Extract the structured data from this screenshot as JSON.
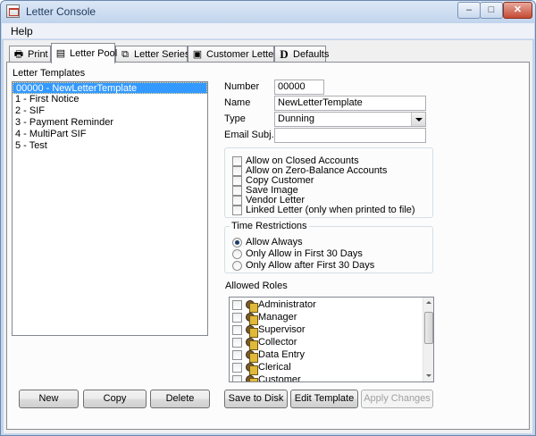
{
  "window": {
    "title": "Letter Console",
    "min": "–",
    "max": "□",
    "close": "✕"
  },
  "menu": {
    "help": "Help"
  },
  "tabs": [
    {
      "label": "Print",
      "icon": "printer-icon",
      "glyph": "🖶"
    },
    {
      "label": "Letter Pool",
      "icon": "document-icon",
      "glyph": "▤",
      "active": true
    },
    {
      "label": "Letter Series",
      "icon": "letter-series-icon",
      "glyph": "⧉"
    },
    {
      "label": "Customer Letters",
      "icon": "customer-letter-icon",
      "glyph": "▣"
    },
    {
      "label": "Defaults",
      "icon": "defaults-icon",
      "glyph": "D"
    }
  ],
  "letter_templates": {
    "heading": "Letter Templates",
    "items": [
      "00000 - NewLetterTemplate",
      "1 - First Notice",
      "2 - SIF",
      "3 - Payment Reminder",
      "4 - MultiPart SIF",
      "5 - Test"
    ]
  },
  "form": {
    "number_label": "Number",
    "number_value": "00000",
    "name_label": "Name",
    "name_value": "NewLetterTemplate",
    "type_label": "Type",
    "type_value": "Dunning",
    "email_label": "Email Subj.",
    "email_value": ""
  },
  "options": [
    "Allow on Closed Accounts",
    "Allow on Zero-Balance Accounts",
    "Copy Customer",
    "Save Image",
    "Vendor Letter",
    "Linked Letter (only when printed to file)"
  ],
  "time_restrictions": {
    "title": "Time Restrictions",
    "choices": [
      "Allow Always",
      "Only Allow in First 30 Days",
      "Only Allow after First 30 Days"
    ],
    "selected": "Allow Always"
  },
  "allowed_roles": {
    "title": "Allowed Roles",
    "roles": [
      "Administrator",
      "Manager",
      "Supervisor",
      "Collector",
      "Data Entry",
      "Clerical",
      "Customer"
    ]
  },
  "buttons": {
    "new": "New",
    "copy": "Copy",
    "delete": "Delete",
    "save_to_disk": "Save to Disk",
    "edit_template": "Edit Template",
    "apply_changes": "Apply Changes"
  }
}
